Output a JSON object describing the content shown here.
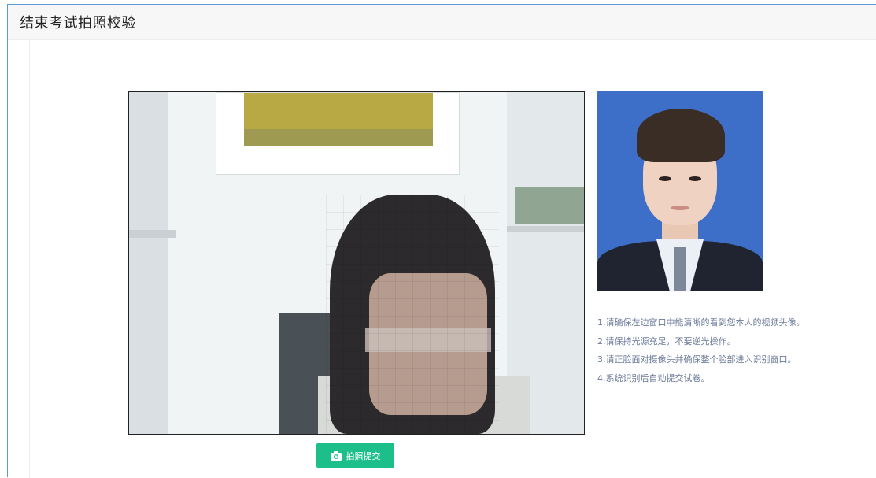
{
  "header": {
    "title": "结束考试拍照校验"
  },
  "video": {
    "alt": "camera-feed"
  },
  "reference_photo": {
    "alt": "registered-photo"
  },
  "instructions": [
    "1.请确保左边窗口中能清晰的看到您本人的视频头像。",
    "2.请保持光源充足，不要逆光操作。",
    "3.请正脸面对摄像头并确保整个脸部进入识别窗口。",
    "4.系统识别后自动提交试卷。"
  ],
  "submit": {
    "label": "拍照提交",
    "icon": "camera-icon"
  },
  "colors": {
    "accent": "#1cbf8a",
    "frame_border": "#5b9bd5",
    "instruction_text": "#6b7a9a"
  }
}
